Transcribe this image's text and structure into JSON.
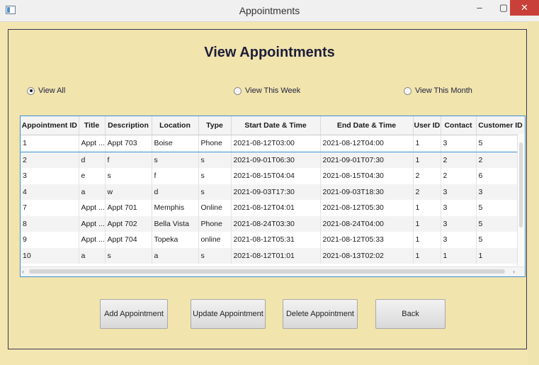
{
  "window": {
    "title": "Appointments",
    "min": "–",
    "max": "▢",
    "close": "✕"
  },
  "page": {
    "heading": "View Appointments"
  },
  "filters": [
    {
      "label": "View All",
      "checked": true
    },
    {
      "label": "View This Week",
      "checked": false
    },
    {
      "label": "View This Month",
      "checked": false
    }
  ],
  "table": {
    "columns": [
      "Appointment ID",
      "Title",
      "Description",
      "Location",
      "Type",
      "Start Date & Time",
      "End Date & Time",
      "User ID",
      "Contact",
      "Customer ID"
    ],
    "rows": [
      [
        "1",
        "Appt ...",
        "Appt 703",
        "Boise",
        "Phone",
        "2021-08-12T03:00",
        "2021-08-12T04:00",
        "1",
        "3",
        "5"
      ],
      [
        "2",
        "d",
        "f",
        "s",
        "s",
        "2021-09-01T06:30",
        "2021-09-01T07:30",
        "1",
        "2",
        "2"
      ],
      [
        "3",
        "e",
        "s",
        "f",
        "s",
        "2021-08-15T04:04",
        "2021-08-15T04:30",
        "2",
        "2",
        "6"
      ],
      [
        "4",
        "a",
        "w",
        "d",
        "s",
        "2021-09-03T17:30",
        "2021-09-03T18:30",
        "2",
        "3",
        "3"
      ],
      [
        "7",
        "Appt ...",
        "Appt 701",
        "Memphis",
        "Online",
        "2021-08-12T04:01",
        "2021-08-12T05:30",
        "1",
        "3",
        "5"
      ],
      [
        "8",
        "Appt ...",
        "Appt 702",
        "Bella Vista",
        "Phone",
        "2021-08-24T03:30",
        "2021-08-24T04:00",
        "1",
        "3",
        "5"
      ],
      [
        "9",
        "Appt ...",
        "Appt 704",
        "Topeka",
        "online",
        "2021-08-12T05:31",
        "2021-08-12T05:33",
        "1",
        "3",
        "5"
      ],
      [
        "10",
        "a",
        "s",
        "a",
        "s",
        "2021-08-12T01:01",
        "2021-08-13T02:02",
        "1",
        "1",
        "1"
      ]
    ]
  },
  "buttons": {
    "add": "Add Appointment",
    "update": "Update Appointment",
    "delete": "Delete Appointment",
    "back": "Back"
  }
}
